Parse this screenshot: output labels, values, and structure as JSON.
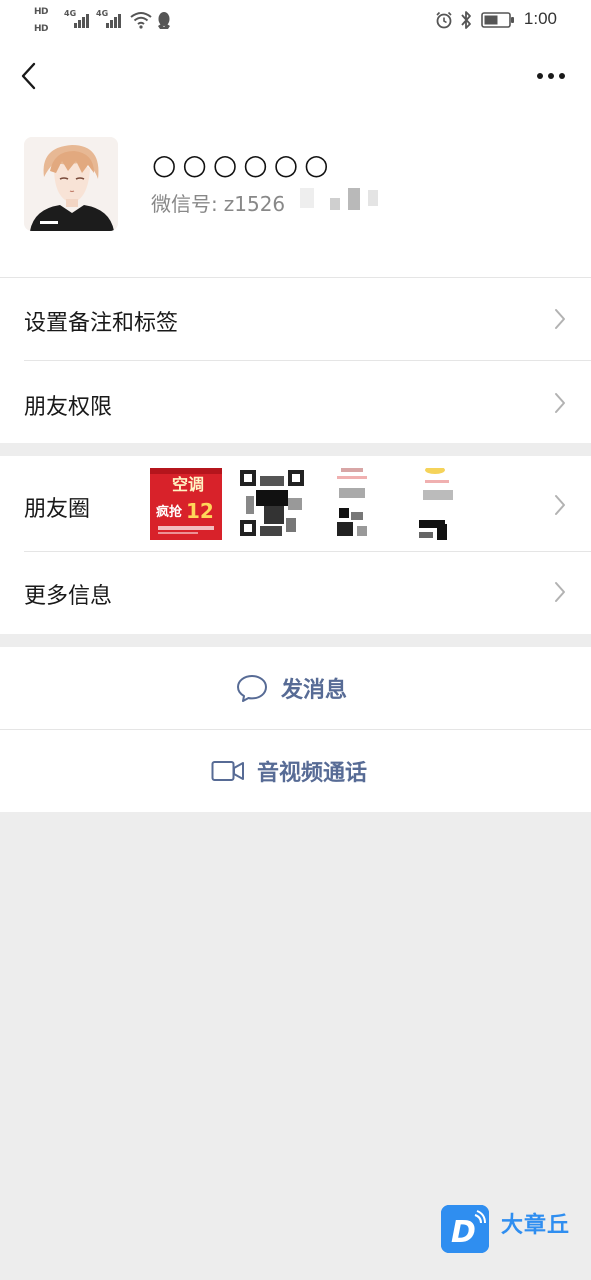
{
  "status_bar": {
    "hd1": "HD",
    "hd2": "HD",
    "net1": "4G",
    "net2": "4G",
    "time": "1:00"
  },
  "nav": {
    "back_icon": "chevron-left-icon",
    "more_icon": "more-dots-icon"
  },
  "profile": {
    "nickname": "○○○○○○",
    "wechat_id_label": "微信号:",
    "wechat_id_value": "z1526"
  },
  "menu": {
    "remark_tags": "设置备注和标签",
    "friend_permissions": "朋友权限",
    "moments": "朋友圈",
    "more_info": "更多信息"
  },
  "moments_thumbs": {
    "poster_line1": "空调",
    "poster_line2": "12",
    "poster_prefix": "疯抢"
  },
  "actions": {
    "send_message": "发消息",
    "video_call": "音视频通话"
  },
  "watermark": {
    "brand": "大章丘",
    "logo_letter": "D"
  },
  "colors": {
    "background": "#ededed",
    "link_blue": "#576b95",
    "brand_blue": "#2f8ef0",
    "poster_red": "#d8222a"
  }
}
